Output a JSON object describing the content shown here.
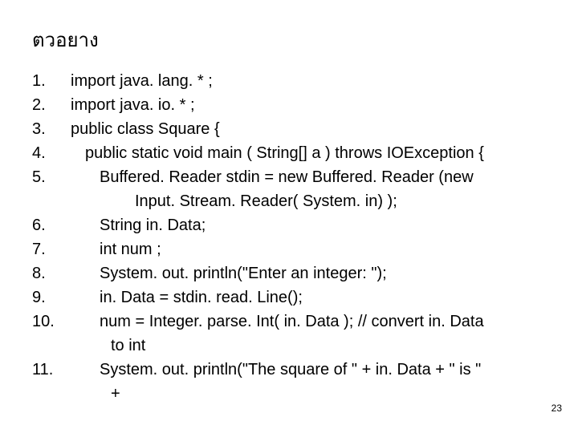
{
  "title": "ตวอยาง",
  "lines": [
    {
      "num": "1.",
      "text": "import java. lang. * ;"
    },
    {
      "num": "2.",
      "text": "import java. io. * ;"
    },
    {
      "num": "3.",
      "text": "public class Square {"
    },
    {
      "num": "4.",
      "text": "public static void main ( String[] a ) throws IOException {"
    },
    {
      "num": "5.",
      "text": "Buffered. Reader stdin =   new Buffered. Reader (new"
    },
    {
      "num": "",
      "text": "Input. Stream. Reader( System. in) );"
    },
    {
      "num": "6.",
      "text": "String in. Data;"
    },
    {
      "num": "7.",
      "text": "int num ;"
    },
    {
      "num": "8.",
      "text": "System. out. println(\"Enter an integer: \");"
    },
    {
      "num": "9.",
      "text": "in. Data = stdin. read. Line();"
    },
    {
      "num": "10.",
      "text": "num = Integer. parse. Int( in. Data ); // convert in. Data"
    },
    {
      "num": "",
      "text": "to int"
    },
    {
      "num": "11.",
      "text": "System. out. println(\"The square of \" + in. Data + \" is \""
    },
    {
      "num": "",
      "text": "+"
    }
  ],
  "page_number": "23"
}
